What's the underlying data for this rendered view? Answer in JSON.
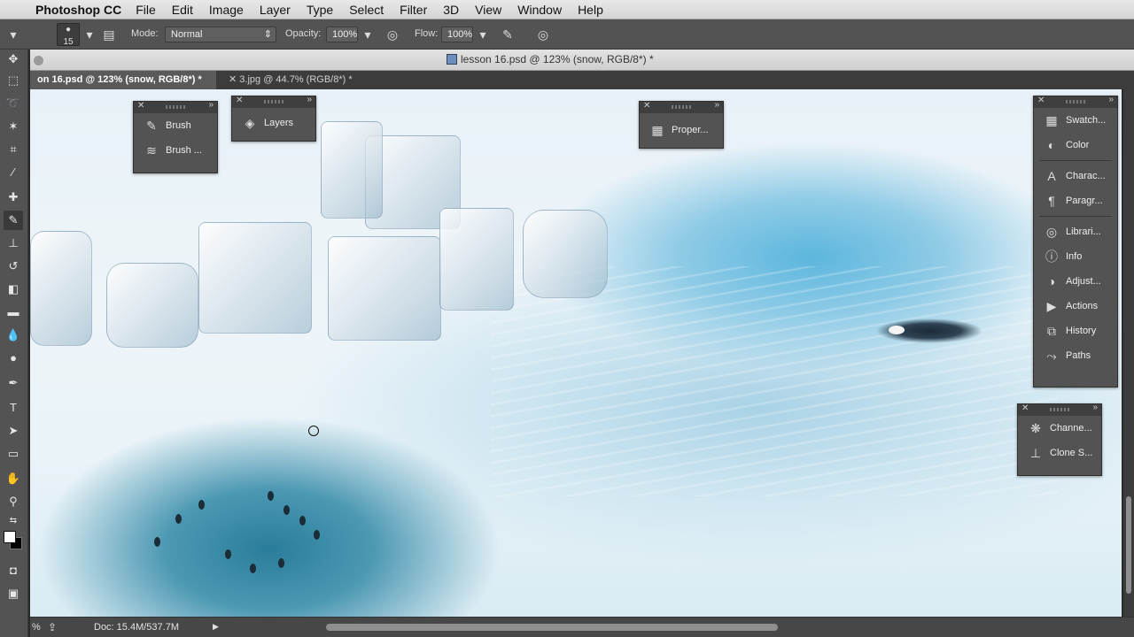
{
  "menubar": {
    "app_name": "Photoshop CC",
    "items": [
      "File",
      "Edit",
      "Image",
      "Layer",
      "Type",
      "Select",
      "Filter",
      "3D",
      "View",
      "Window",
      "Help"
    ]
  },
  "options": {
    "brush_size": "15",
    "mode_label": "Mode:",
    "mode_value": "Normal",
    "opacity_label": "Opacity:",
    "opacity_value": "100%",
    "flow_label": "Flow:",
    "flow_value": "100%"
  },
  "window": {
    "title": "lesson 16.psd @ 123% (snow, RGB/8*) *"
  },
  "tabs": [
    {
      "label": "on 16.psd @ 123% (snow, RGB/8*) *",
      "active": true
    },
    {
      "label": "3.jpg @ 44.7% (RGB/8*) *",
      "active": false
    }
  ],
  "panels": {
    "brush_group": [
      "Brush",
      "Brush ..."
    ],
    "layers": "Layers",
    "properties": "Proper...",
    "right_dock": [
      "Swatch...",
      "Color",
      "Charac...",
      "Paragr...",
      "Librari...",
      "Info",
      "Adjust...",
      "Actions",
      "History",
      "Paths"
    ],
    "small_dock": [
      "Channe...",
      "Clone S..."
    ]
  },
  "status": {
    "zoom": "%",
    "doc": "Doc: 15.4M/537.7M"
  },
  "colors": {
    "foreground": "#ffffff",
    "background": "#000000"
  }
}
